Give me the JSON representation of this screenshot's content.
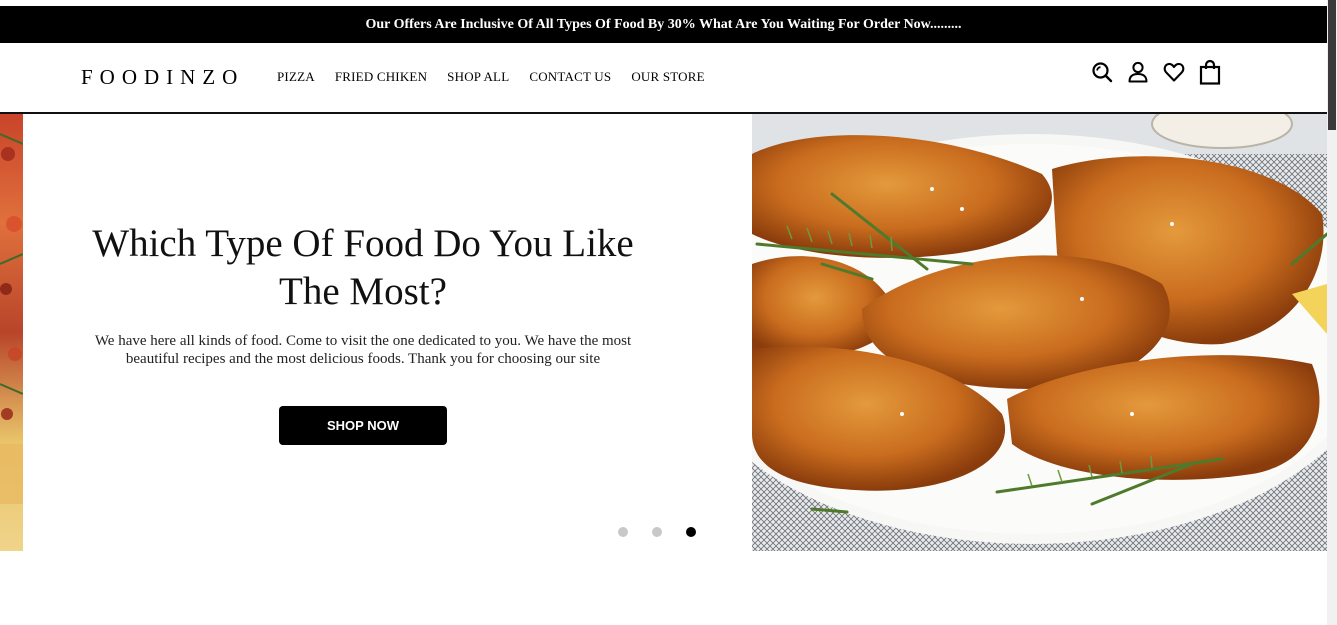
{
  "announcement": {
    "text": "Our Offers Are Inclusive Of All Types Of Food By 30% What Are You Waiting For Order Now........."
  },
  "header": {
    "logo": "FOODINZO",
    "nav": [
      {
        "label": "PIZZA"
      },
      {
        "label": "FRIED CHIKEN"
      },
      {
        "label": "SHOP ALL"
      },
      {
        "label": "CONTACT US"
      },
      {
        "label": "OUR STORE"
      }
    ],
    "icons": [
      "search-icon",
      "user-icon",
      "heart-icon",
      "shopping-bag-icon"
    ]
  },
  "hero": {
    "title": "Which Type Of Food Do You Like The Most?",
    "description": "We have here all kinds of food. Come to visit the one dedicated to you. We have the most beautiful recipes and the most delicious foods. Thank you for choosing our site",
    "button_label": "SHOP NOW",
    "slides_total": 3,
    "active_slide": 3
  },
  "colors": {
    "announcement_bg": "#000000",
    "button_bg": "#000000",
    "dot_inactive": "#c8c8c8",
    "dot_active": "#000000"
  }
}
